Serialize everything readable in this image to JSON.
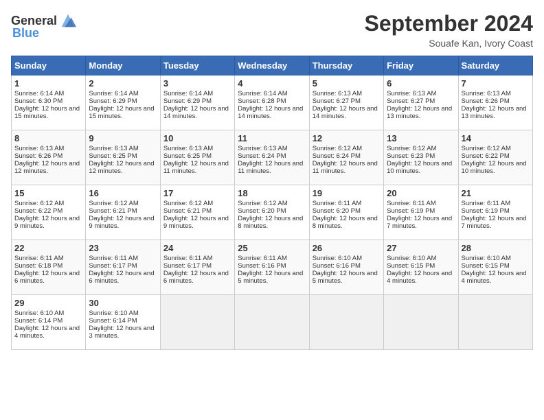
{
  "header": {
    "logo_general": "General",
    "logo_blue": "Blue",
    "month_title": "September 2024",
    "location": "Souafe Kan, Ivory Coast"
  },
  "calendar": {
    "days_of_week": [
      "Sunday",
      "Monday",
      "Tuesday",
      "Wednesday",
      "Thursday",
      "Friday",
      "Saturday"
    ],
    "weeks": [
      [
        {
          "day": "1",
          "sunrise": "6:14 AM",
          "sunset": "6:30 PM",
          "daylight": "12 hours and 15 minutes."
        },
        {
          "day": "2",
          "sunrise": "6:14 AM",
          "sunset": "6:29 PM",
          "daylight": "12 hours and 15 minutes."
        },
        {
          "day": "3",
          "sunrise": "6:14 AM",
          "sunset": "6:29 PM",
          "daylight": "12 hours and 14 minutes."
        },
        {
          "day": "4",
          "sunrise": "6:14 AM",
          "sunset": "6:28 PM",
          "daylight": "12 hours and 14 minutes."
        },
        {
          "day": "5",
          "sunrise": "6:13 AM",
          "sunset": "6:27 PM",
          "daylight": "12 hours and 14 minutes."
        },
        {
          "day": "6",
          "sunrise": "6:13 AM",
          "sunset": "6:27 PM",
          "daylight": "12 hours and 13 minutes."
        },
        {
          "day": "7",
          "sunrise": "6:13 AM",
          "sunset": "6:26 PM",
          "daylight": "12 hours and 13 minutes."
        }
      ],
      [
        {
          "day": "8",
          "sunrise": "6:13 AM",
          "sunset": "6:26 PM",
          "daylight": "12 hours and 12 minutes."
        },
        {
          "day": "9",
          "sunrise": "6:13 AM",
          "sunset": "6:25 PM",
          "daylight": "12 hours and 12 minutes."
        },
        {
          "day": "10",
          "sunrise": "6:13 AM",
          "sunset": "6:25 PM",
          "daylight": "12 hours and 11 minutes."
        },
        {
          "day": "11",
          "sunrise": "6:13 AM",
          "sunset": "6:24 PM",
          "daylight": "12 hours and 11 minutes."
        },
        {
          "day": "12",
          "sunrise": "6:12 AM",
          "sunset": "6:24 PM",
          "daylight": "12 hours and 11 minutes."
        },
        {
          "day": "13",
          "sunrise": "6:12 AM",
          "sunset": "6:23 PM",
          "daylight": "12 hours and 10 minutes."
        },
        {
          "day": "14",
          "sunrise": "6:12 AM",
          "sunset": "6:22 PM",
          "daylight": "12 hours and 10 minutes."
        }
      ],
      [
        {
          "day": "15",
          "sunrise": "6:12 AM",
          "sunset": "6:22 PM",
          "daylight": "12 hours and 9 minutes."
        },
        {
          "day": "16",
          "sunrise": "6:12 AM",
          "sunset": "6:21 PM",
          "daylight": "12 hours and 9 minutes."
        },
        {
          "day": "17",
          "sunrise": "6:12 AM",
          "sunset": "6:21 PM",
          "daylight": "12 hours and 9 minutes."
        },
        {
          "day": "18",
          "sunrise": "6:12 AM",
          "sunset": "6:20 PM",
          "daylight": "12 hours and 8 minutes."
        },
        {
          "day": "19",
          "sunrise": "6:11 AM",
          "sunset": "6:20 PM",
          "daylight": "12 hours and 8 minutes."
        },
        {
          "day": "20",
          "sunrise": "6:11 AM",
          "sunset": "6:19 PM",
          "daylight": "12 hours and 7 minutes."
        },
        {
          "day": "21",
          "sunrise": "6:11 AM",
          "sunset": "6:19 PM",
          "daylight": "12 hours and 7 minutes."
        }
      ],
      [
        {
          "day": "22",
          "sunrise": "6:11 AM",
          "sunset": "6:18 PM",
          "daylight": "12 hours and 6 minutes."
        },
        {
          "day": "23",
          "sunrise": "6:11 AM",
          "sunset": "6:17 PM",
          "daylight": "12 hours and 6 minutes."
        },
        {
          "day": "24",
          "sunrise": "6:11 AM",
          "sunset": "6:17 PM",
          "daylight": "12 hours and 6 minutes."
        },
        {
          "day": "25",
          "sunrise": "6:11 AM",
          "sunset": "6:16 PM",
          "daylight": "12 hours and 5 minutes."
        },
        {
          "day": "26",
          "sunrise": "6:10 AM",
          "sunset": "6:16 PM",
          "daylight": "12 hours and 5 minutes."
        },
        {
          "day": "27",
          "sunrise": "6:10 AM",
          "sunset": "6:15 PM",
          "daylight": "12 hours and 4 minutes."
        },
        {
          "day": "28",
          "sunrise": "6:10 AM",
          "sunset": "6:15 PM",
          "daylight": "12 hours and 4 minutes."
        }
      ],
      [
        {
          "day": "29",
          "sunrise": "6:10 AM",
          "sunset": "6:14 PM",
          "daylight": "12 hours and 4 minutes."
        },
        {
          "day": "30",
          "sunrise": "6:10 AM",
          "sunset": "6:14 PM",
          "daylight": "12 hours and 3 minutes."
        },
        null,
        null,
        null,
        null,
        null
      ]
    ]
  }
}
